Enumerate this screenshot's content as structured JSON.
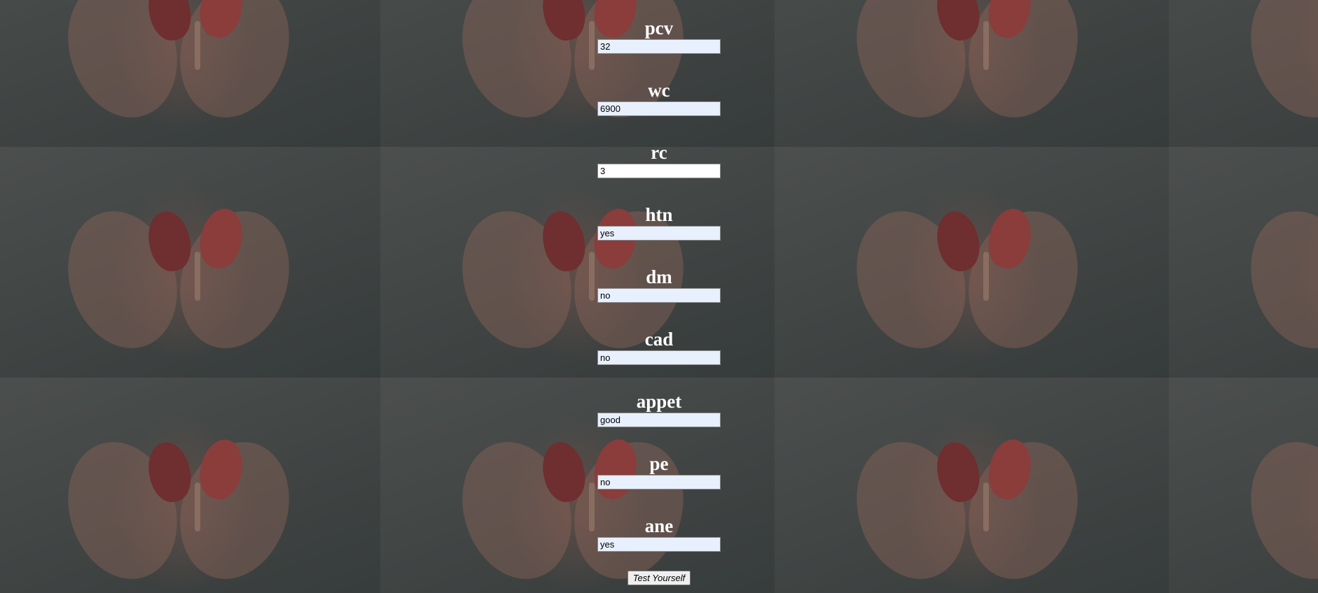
{
  "fields": [
    {
      "label": "pcv",
      "value": "32"
    },
    {
      "label": "wc",
      "value": "6900"
    },
    {
      "label": "rc",
      "value": "3"
    },
    {
      "label": "htn",
      "value": "yes"
    },
    {
      "label": "dm",
      "value": "no"
    },
    {
      "label": "cad",
      "value": "no"
    },
    {
      "label": "appet",
      "value": "good"
    },
    {
      "label": "pe",
      "value": "no"
    },
    {
      "label": "ane",
      "value": "yes"
    }
  ],
  "submit": {
    "label": "Test Yourself"
  },
  "colors": {
    "label_text": "#ffffff",
    "autofill_bg": "#e8f0fe",
    "overlay": "#3e4241"
  },
  "background": {
    "icon": "kidneys-in-hands-image"
  }
}
